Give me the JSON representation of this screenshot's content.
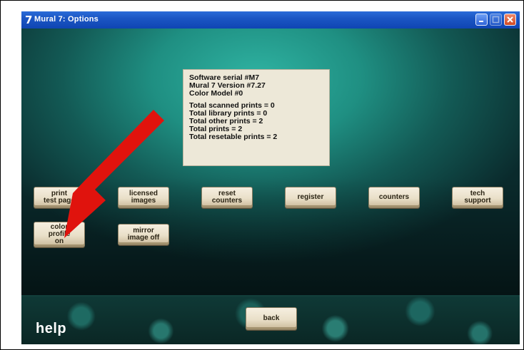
{
  "window": {
    "title": "Mural   7: Options",
    "app_icon_glyph": "7"
  },
  "info": {
    "lines1": [
      "Software serial #M7",
      "Mural   7 Version #7.27",
      "Color Model #0"
    ],
    "lines2": [
      "Total scanned prints = 0",
      "Total library prints = 0",
      "Total other prints = 2",
      "Total prints = 2",
      "Total resetable prints = 2"
    ]
  },
  "buttons": {
    "print_test_page": [
      "print",
      "test page"
    ],
    "licensed_images": [
      "licensed",
      "images"
    ],
    "reset_counters": [
      "reset",
      "counters"
    ],
    "register": [
      "register"
    ],
    "counters": [
      "counters"
    ],
    "tech_support": [
      "tech",
      "support"
    ],
    "color_profile": [
      "color",
      "profile",
      "on"
    ],
    "mirror_image": [
      "mirror",
      "image off"
    ],
    "back": "back"
  },
  "help_label": "help",
  "colors": {
    "arrow": "#e0130d",
    "titlebar": "#1b56c4",
    "panel": "#ede8d8"
  },
  "icons": {
    "minimize": "minimize-icon",
    "maximize": "maximize-icon",
    "close": "close-icon",
    "annotation": "red-arrow-icon"
  }
}
